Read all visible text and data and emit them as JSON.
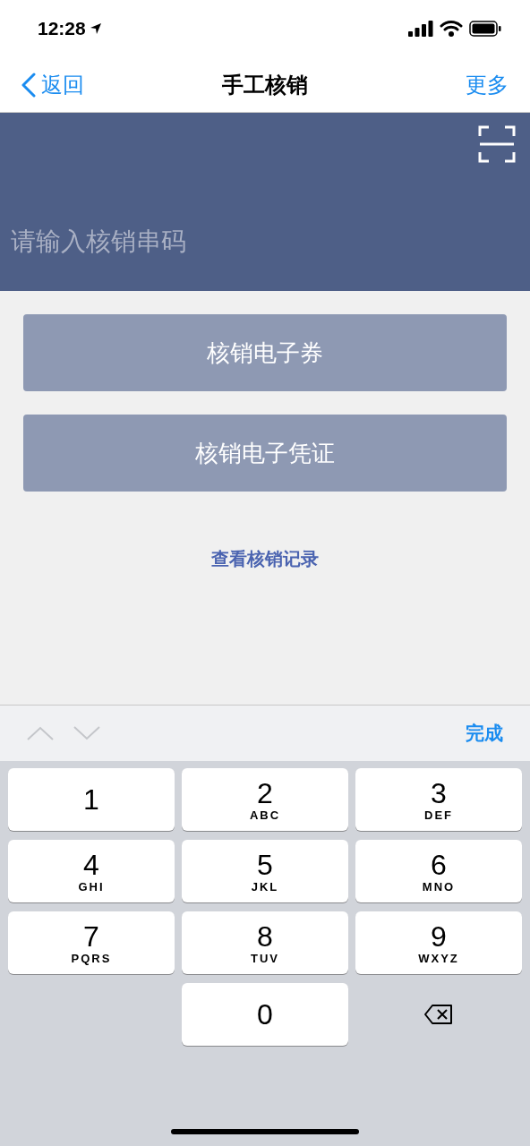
{
  "status_bar": {
    "time": "12:28"
  },
  "nav": {
    "back": "返回",
    "title": "手工核销",
    "more": "更多"
  },
  "input": {
    "placeholder": "请输入核销串码"
  },
  "buttons": [
    "核销电子券",
    "核销电子凭证"
  ],
  "link": "查看核销记录",
  "keyboard_toolbar": {
    "done": "完成"
  },
  "keys": [
    {
      "kind": "digit",
      "digit": "1"
    },
    {
      "kind": "digit",
      "digit": "2",
      "letters": "ABC"
    },
    {
      "kind": "digit",
      "digit": "3",
      "letters": "DEF"
    },
    {
      "kind": "digit",
      "digit": "4",
      "letters": "GHI"
    },
    {
      "kind": "digit",
      "digit": "5",
      "letters": "JKL"
    },
    {
      "kind": "digit",
      "digit": "6",
      "letters": "MNO"
    },
    {
      "kind": "digit",
      "digit": "7",
      "letters": "PQRS"
    },
    {
      "kind": "digit",
      "digit": "8",
      "letters": "TUV"
    },
    {
      "kind": "digit",
      "digit": "9",
      "letters": "WXYZ"
    },
    {
      "kind": "blank"
    },
    {
      "kind": "digit",
      "digit": "0"
    },
    {
      "kind": "delete"
    }
  ]
}
